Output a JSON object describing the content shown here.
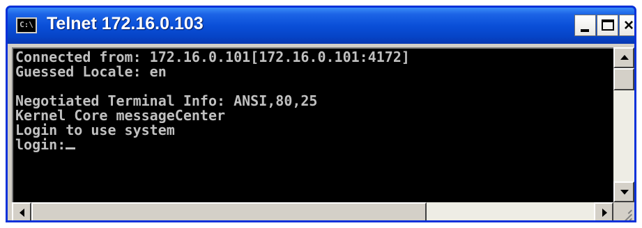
{
  "window": {
    "title": "Telnet 172.16.0.103",
    "icon_text": "C:\\",
    "icon": "console-icon"
  },
  "controls": {
    "minimize_icon": "minimize-icon",
    "maximize_icon": "maximize-icon",
    "close_glyph": "×"
  },
  "console": {
    "foreground": "#c0c0c0",
    "background": "#000000",
    "lines": [
      "Connected from: 172.16.0.101[172.16.0.101:4172]",
      "Guessed Locale: en",
      "",
      "Negotiated Terminal Info: ANSI,80,25",
      "Kernel Core messageCenter",
      "Login to use system",
      "login:"
    ]
  },
  "colors": {
    "titlebar": "#0a4fd8",
    "frame": "#d4d0c8"
  }
}
